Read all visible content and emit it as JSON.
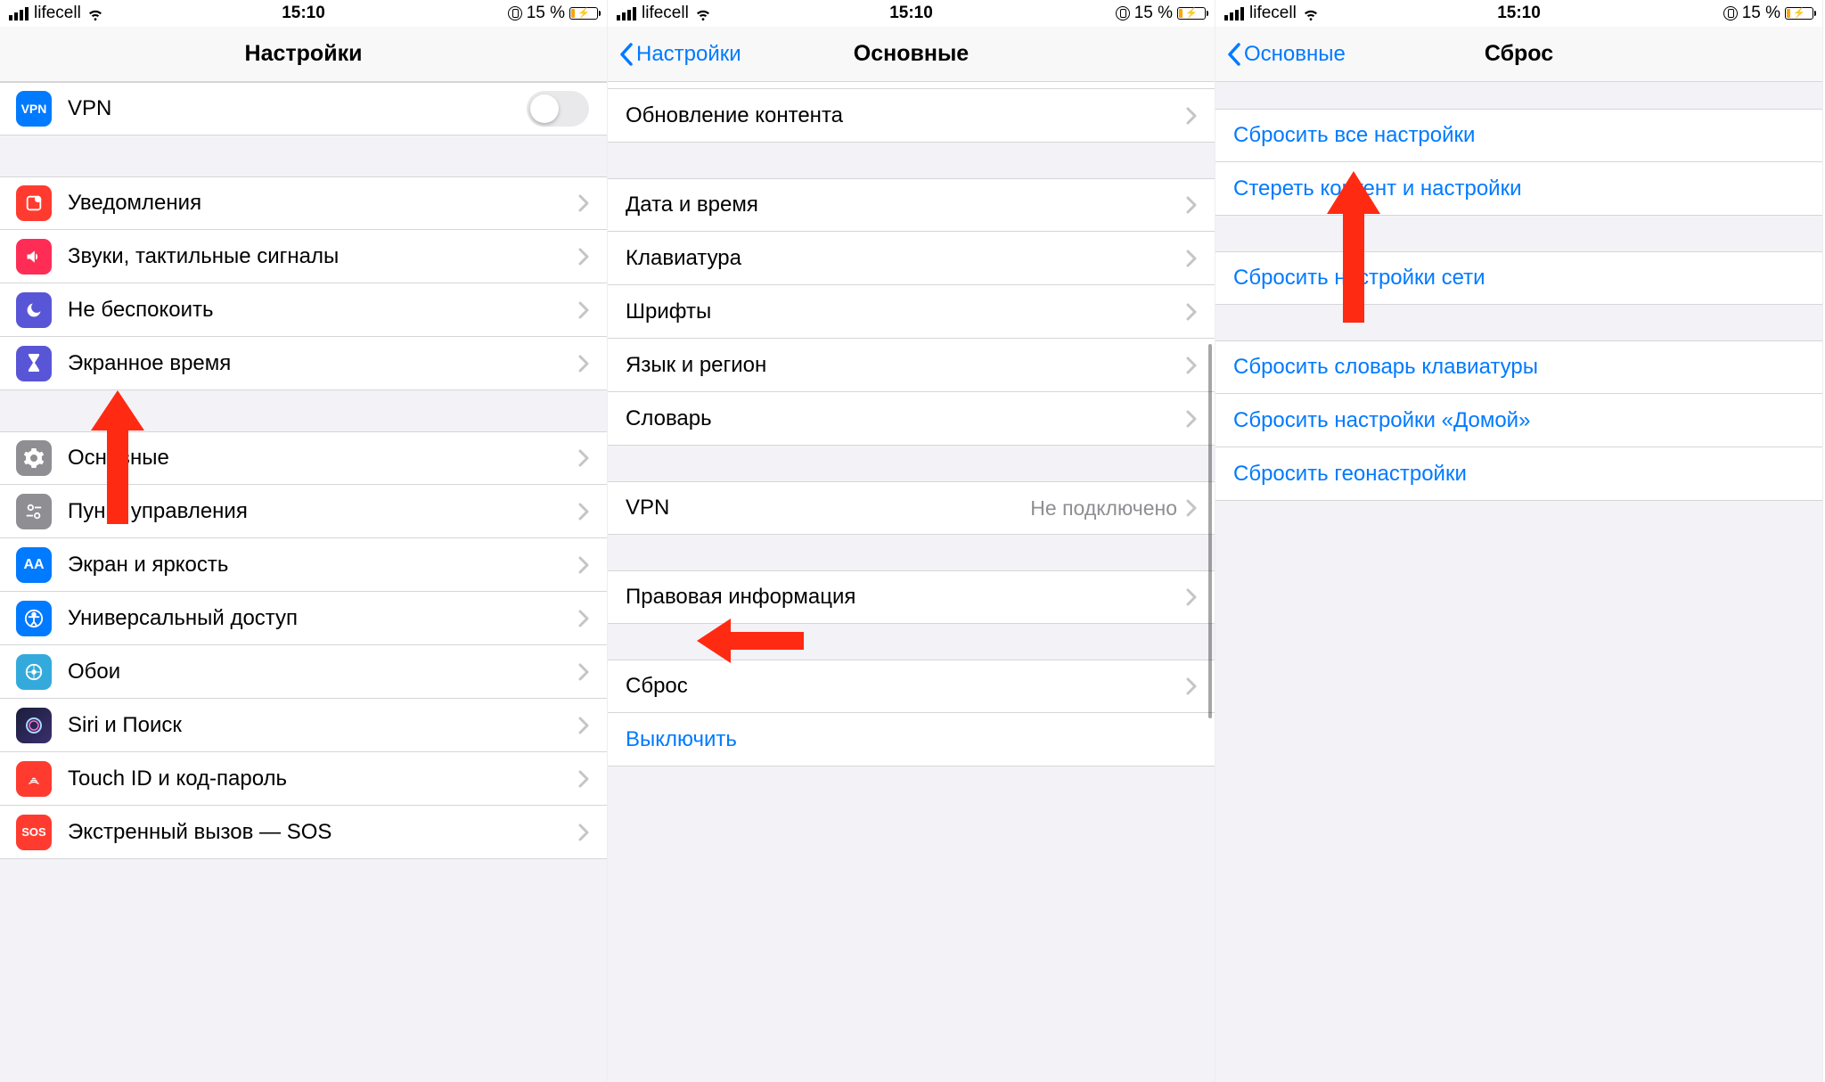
{
  "status": {
    "carrier": "lifecell",
    "time": "15:10",
    "battery_text": "15 %"
  },
  "screen1": {
    "title": "Настройки",
    "vpn": {
      "label": "VPN",
      "badge": "VPN"
    },
    "items": [
      {
        "label": "Уведомления"
      },
      {
        "label": "Звуки, тактильные сигналы"
      },
      {
        "label": "Не беспокоить"
      },
      {
        "label": "Экранное время"
      }
    ],
    "group2": [
      {
        "label": "Основные"
      },
      {
        "label": "Пункт управления"
      },
      {
        "label": "Экран и яркость"
      },
      {
        "label": "Универсальный доступ"
      },
      {
        "label": "Обои"
      },
      {
        "label": "Siri и Поиск"
      },
      {
        "label": "Touch ID и код‑пароль"
      },
      {
        "label": "Экстренный вызов — SOS",
        "badge": "SOS"
      }
    ]
  },
  "screen2": {
    "back": "Настройки",
    "title": "Основные",
    "g1": [
      {
        "label": "Обновление контента"
      }
    ],
    "g2": [
      {
        "label": "Дата и время"
      },
      {
        "label": "Клавиатура"
      },
      {
        "label": "Шрифты"
      },
      {
        "label": "Язык и регион"
      },
      {
        "label": "Словарь"
      }
    ],
    "g3": [
      {
        "label": "VPN",
        "detail": "Не подключено"
      }
    ],
    "g4": [
      {
        "label": "Правовая информация"
      }
    ],
    "g5": [
      {
        "label": "Сброс"
      },
      {
        "label": "Выключить",
        "link": true
      }
    ]
  },
  "screen3": {
    "back": "Основные",
    "title": "Сброс",
    "g1": [
      {
        "label": "Сбросить все настройки"
      },
      {
        "label": "Стереть контент и настройки"
      }
    ],
    "g2": [
      {
        "label": "Сбросить настройки сети"
      }
    ],
    "g3": [
      {
        "label": "Сбросить словарь клавиатуры"
      },
      {
        "label": "Сбросить настройки «Домой»"
      },
      {
        "label": "Сбросить геонастройки"
      }
    ]
  }
}
